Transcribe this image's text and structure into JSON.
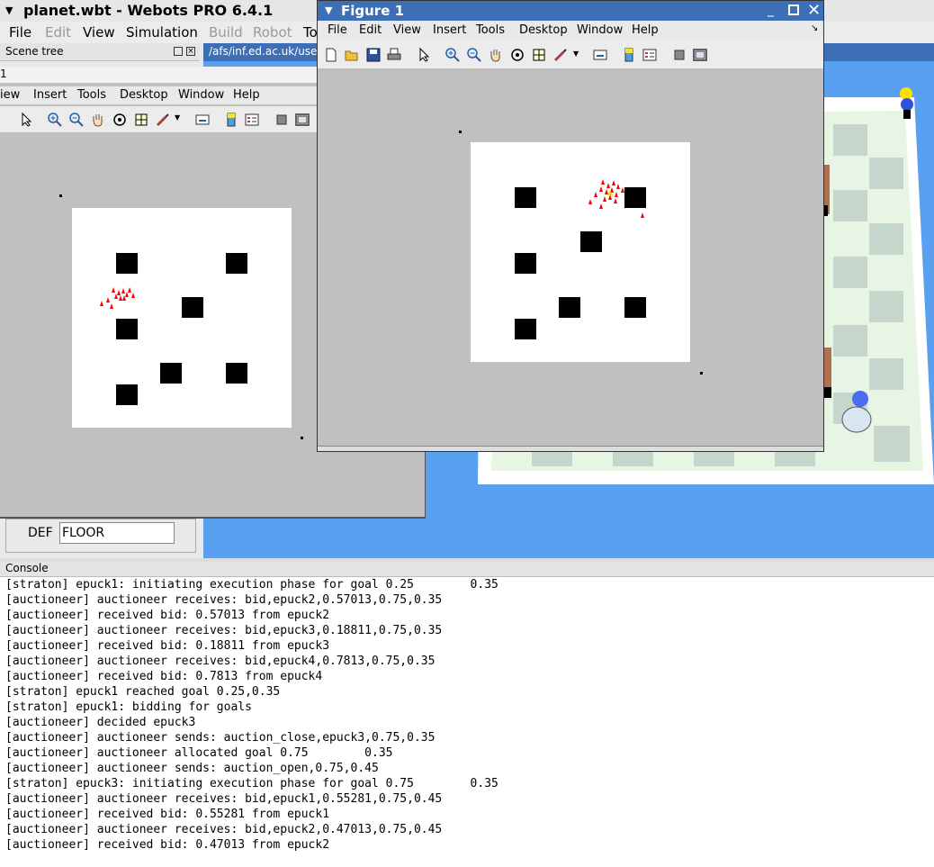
{
  "main_window": {
    "title": "planet.wbt - Webots PRO 6.4.1",
    "menu": [
      "File",
      "Edit",
      "View",
      "Simulation",
      "Build",
      "Robot",
      "To"
    ],
    "scene_tree_label": "Scene tree",
    "path_text": "/afs/inf.ed.ac.uk/user/",
    "def_label": "DEF",
    "def_value": "FLOOR",
    "console_label": "Console",
    "console_lines": [
      "[straton] epuck1: initiating execution phase for goal 0.25        0.35",
      "[auctioneer] auctioneer receives: bid,epuck2,0.57013,0.75,0.35",
      "[auctioneer] received bid: 0.57013 from epuck2",
      "[auctioneer] auctioneer receives: bid,epuck3,0.18811,0.75,0.35",
      "[auctioneer] received bid: 0.18811 from epuck3",
      "[auctioneer] auctioneer receives: bid,epuck4,0.7813,0.75,0.35",
      "[auctioneer] received bid: 0.7813 from epuck4",
      "[straton] epuck1 reached goal 0.25,0.35",
      "[straton] epuck1: bidding for goals",
      "[auctioneer] decided epuck3",
      "[auctioneer] auctioneer sends: auction_close,epuck3,0.75,0.35",
      "[auctioneer] auctioneer allocated goal 0.75        0.35",
      "[auctioneer] auctioneer sends: auction_open,0.75,0.45",
      "[straton] epuck3: initiating execution phase for goal 0.75        0.35",
      "[auctioneer] auctioneer receives: bid,epuck1,0.55281,0.75,0.45",
      "[auctioneer] received bid: 0.55281 from epuck1",
      "[auctioneer] auctioneer receives: bid,epuck2,0.47013,0.75,0.45",
      "[auctioneer] received bid: 0.47013 from epuck2"
    ]
  },
  "back_figure": {
    "title_fragment": "1",
    "menu": [
      "iew",
      "Insert",
      "Tools",
      "Desktop",
      "Window",
      "Help"
    ]
  },
  "figure1": {
    "title": "Figure 1",
    "menu": [
      "File",
      "Edit",
      "View",
      "Insert",
      "Tools",
      "Desktop",
      "Window",
      "Help"
    ]
  },
  "colors": {
    "figure_bg": "#c0c0c0",
    "world_sky": "#5aa0f0",
    "robot_red": "#ff0000",
    "titlebar_blue": "#3d6fb6"
  }
}
